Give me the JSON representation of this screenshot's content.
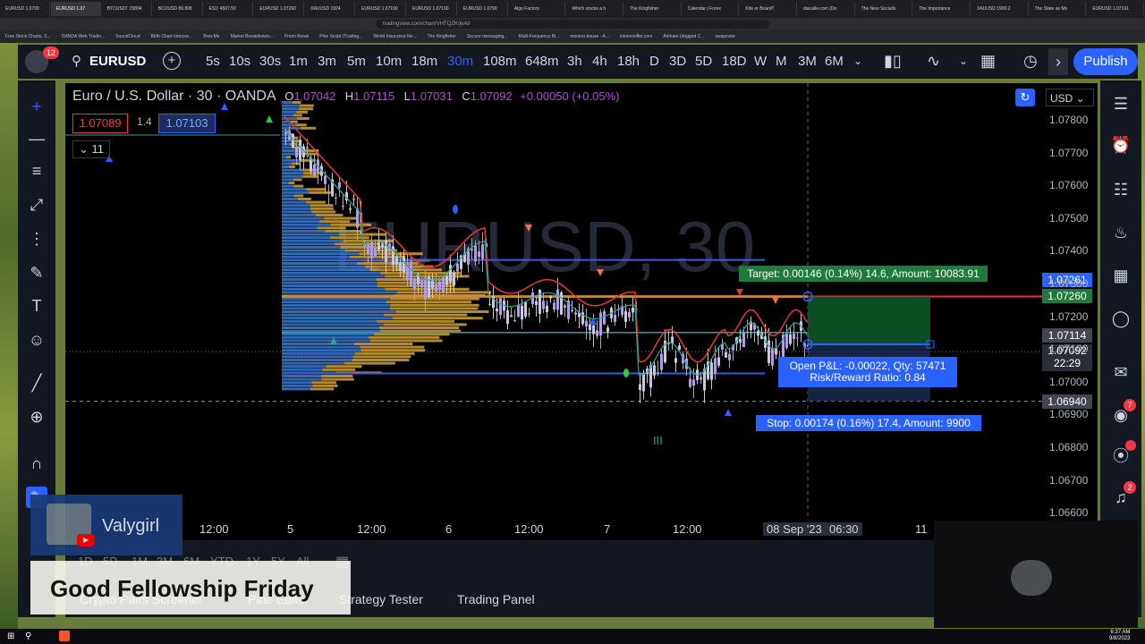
{
  "browser": {
    "tabs": [
      "EURUSD 1.0709",
      "EURUSD 1.07",
      "BTCUSDT 25894",
      "BCOUSD 89.808",
      "ES1! 4507.50",
      "EURUSD 1.07260",
      "XAUUSD 1924",
      "EURUSD 1.07190",
      "EURUSD 1.07190",
      "EURUSD 1.0790",
      "Algo Factory",
      "Which stocks a h",
      "The Kingfisher",
      "Calendar | Forex",
      "Kite or Board?",
      "diacalle.com (Do",
      "The New Socialis",
      "The Importance",
      "XAUUSD 1900.2",
      "The State as Mo",
      "EURUSD 1.07191"
    ],
    "url": "tradingview.com/chart/VHTQZK/jeAl/",
    "bookmarks": [
      "Free Stock Charts, S...",
      "OANDA Web Tradin...",
      "SoundCloud",
      "Birth Chart Interpre...",
      "Brev.Me",
      "Market Breakdowns...",
      "Prism Break",
      "Pine Script (Trading...",
      "World Insurance Ne...",
      "The Kingfisher",
      "Secure messaging...",
      "Multi-Frequency Bi...",
      "monero.bouse - A...",
      "tokensniffer.com",
      "Arkham (dogged C...",
      "swapzone"
    ]
  },
  "header": {
    "notif_count": "12",
    "symbol": "EURUSD",
    "timeframes": [
      "5s",
      "10s",
      "30s",
      "1m",
      "3m",
      "5m",
      "10m",
      "18m",
      "30m",
      "108m",
      "648m",
      "3h",
      "4h",
      "18h",
      "D",
      "3D",
      "5D",
      "18D",
      "W",
      "M",
      "3M",
      "6M"
    ],
    "active_tf": "30m",
    "publish": "Publish"
  },
  "legend": {
    "title": "Euro / U.S. Dollar · 30 · OANDA",
    "o_label": "O",
    "o": "1.07042",
    "h_label": "H",
    "h": "1.07115",
    "l_label": "L",
    "l": "1.07031",
    "c_label": "C",
    "c": "1.07092",
    "change": "+0.00050 (+0.05%)",
    "sell": "1.07089",
    "spread": "1.4",
    "buy": "1.07103",
    "indicators_count": "11"
  },
  "watermark": "EURUSD, 30",
  "currency": "USD",
  "price_axis": [
    "1.07800",
    "1.07700",
    "1.07600",
    "1.07500",
    "1.07400",
    "1.07300",
    "1.07200",
    "1.07100",
    "1.07000",
    "1.06900",
    "1.06800",
    "1.06700",
    "1.06600"
  ],
  "price_tags": {
    "tag1": "1.07261",
    "tag2": "1.07260",
    "tag3": "1.07114",
    "current": "1.07092",
    "countdown": "22:29",
    "tag4": "1.06940"
  },
  "position": {
    "target": "Target: 0.00146 (0.14%) 14.6, Amount: 10083.91",
    "open_pl": "Open P&L: -0.00022, Qty: 57471",
    "rr": "Risk/Reward Ratio: 0.84",
    "stop": "Stop: 0.00174 (0.16%) 17.4, Amount: 9900"
  },
  "wave_label": "III",
  "time_axis": [
    "12:00",
    "5",
    "12:00",
    "6",
    "12:00",
    "7",
    "12:00",
    "08 Sep '23",
    "06:30",
    "11"
  ],
  "bottom": {
    "ranges": [
      "1D",
      "5D",
      "1M",
      "3M",
      "6M",
      "YTD",
      "1Y",
      "5Y",
      "All"
    ],
    "tabs": [
      "Crypto Pairs Screener",
      "Pine Editor",
      "Strategy Tester",
      "Trading Panel"
    ]
  },
  "overlay": {
    "streamer": "Valygirl",
    "banner": "Good Fellowship Friday"
  },
  "right_badges": {
    "alerts": "7",
    "notifications": "2"
  },
  "taskbar": {
    "time": "6:37 AM",
    "date": "9/8/2023"
  }
}
